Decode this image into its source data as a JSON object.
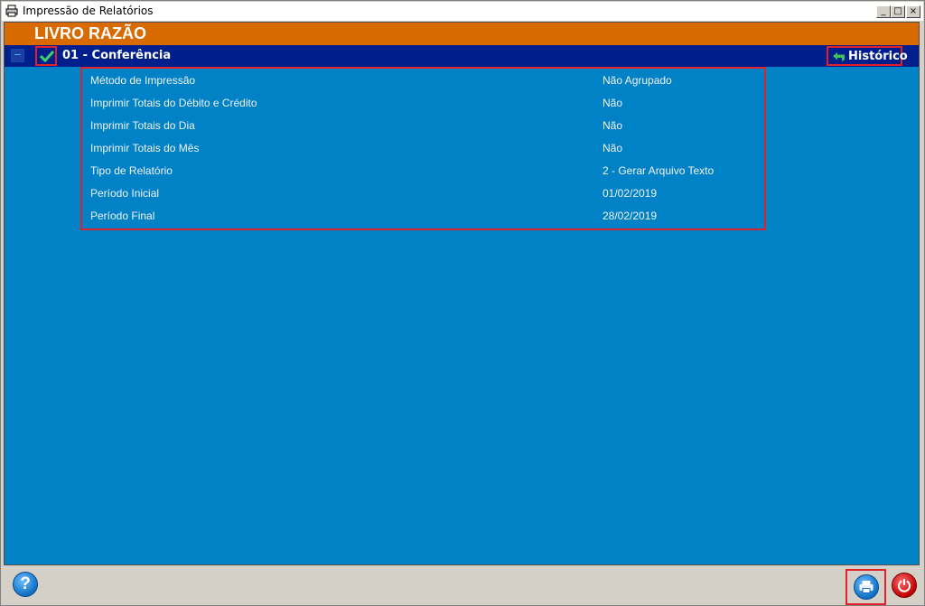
{
  "window": {
    "title": "Impressão de Relatórios",
    "controls": [
      "_",
      "□",
      "×"
    ]
  },
  "header": {
    "title": "LIVRO RAZÃO"
  },
  "group": {
    "label": "01 - Conferência",
    "history_label": "Histórico",
    "collapse_symbol": "−"
  },
  "params": [
    {
      "key": "Método de Impressão",
      "value": "Não Agrupado"
    },
    {
      "key": "Imprimir Totais do Débito e Crédito",
      "value": "Não"
    },
    {
      "key": "Imprimir Totais do Dia",
      "value": "Não"
    },
    {
      "key": "Imprimir Totais do Mês",
      "value": "Não"
    },
    {
      "key": "Tipo de Relatório",
      "value": "2 - Gerar Arquivo Texto"
    },
    {
      "key": "Período Inicial",
      "value": "01/02/2019"
    },
    {
      "key": "Período Final",
      "value": "28/02/2019"
    }
  ],
  "footer": {
    "help_label": "?"
  },
  "icons": {
    "app": "printer-app-icon",
    "check": "check-icon",
    "history": "undo-arrow-icon",
    "help": "help-icon",
    "print": "printer-icon",
    "power": "power-icon"
  },
  "colors": {
    "content_bg": "#0182c6",
    "header_bg": "#d96a00",
    "group_bg": "#001f8c",
    "highlight": "#e0202a"
  }
}
